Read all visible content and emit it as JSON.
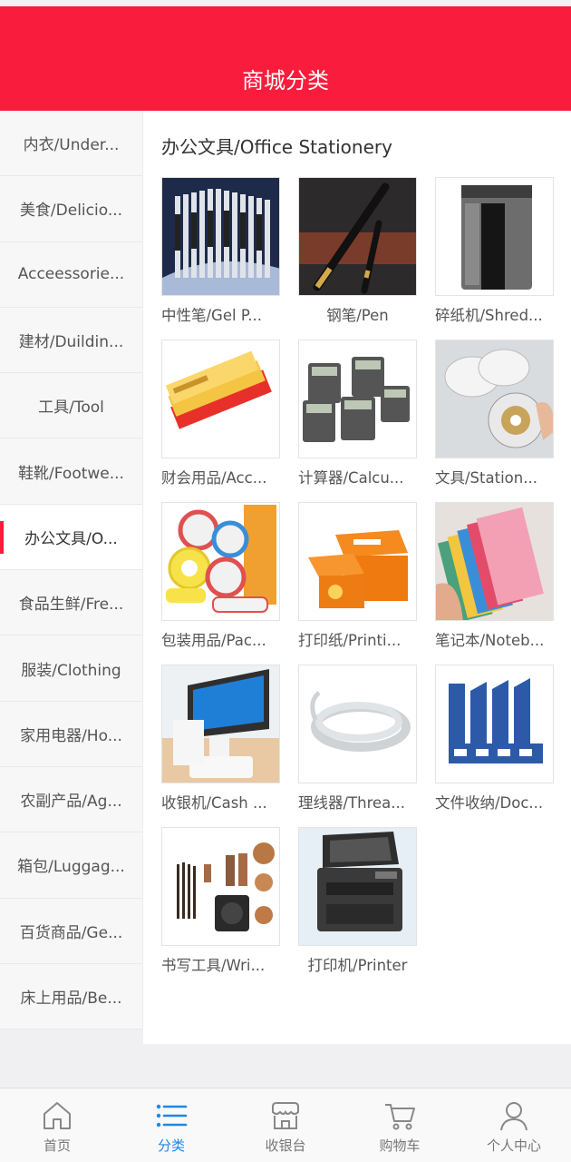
{
  "header": {
    "title": "商城分类"
  },
  "sidebar": {
    "items": [
      {
        "label": "内衣/Under..."
      },
      {
        "label": "美食/Delicio..."
      },
      {
        "label": "Acceessorie..."
      },
      {
        "label": "建材/Duildin..."
      },
      {
        "label": "工具/Tool"
      },
      {
        "label": "鞋靴/Footwe..."
      },
      {
        "label": "办公文具/O...",
        "active": true
      },
      {
        "label": "食品生鲜/Fre..."
      },
      {
        "label": "服装/Clothing"
      },
      {
        "label": "家用电器/Ho..."
      },
      {
        "label": "农副产品/Ag..."
      },
      {
        "label": "箱包/Luggag..."
      },
      {
        "label": "百货商品/Ge..."
      },
      {
        "label": "床上用品/Be..."
      }
    ]
  },
  "main": {
    "title": "办公文具/Office Stationery",
    "products": [
      {
        "label": "中性笔/Gel P...",
        "icon": "gel-pen-image"
      },
      {
        "label": "钢笔/Pen",
        "icon": "fountain-pen-image"
      },
      {
        "label": "碎纸机/Shred...",
        "icon": "shredder-image"
      },
      {
        "label": "财会用品/Acc...",
        "icon": "accounting-supplies-image"
      },
      {
        "label": "计算器/Calcu...",
        "icon": "calculator-image"
      },
      {
        "label": "文具/Station...",
        "icon": "stationery-tape-image"
      },
      {
        "label": "包装用品/Pac...",
        "icon": "packing-tape-image"
      },
      {
        "label": "打印纸/Printi...",
        "icon": "printing-paper-image"
      },
      {
        "label": "笔记本/Noteb...",
        "icon": "notebook-image"
      },
      {
        "label": "收银机/Cash ...",
        "icon": "cash-register-image"
      },
      {
        "label": "理线器/Threa...",
        "icon": "cable-organizer-image"
      },
      {
        "label": "文件收纳/Doc...",
        "icon": "document-holder-image"
      },
      {
        "label": "书写工具/Wri...",
        "icon": "writing-tools-image"
      },
      {
        "label": "打印机/Printer",
        "icon": "printer-image"
      }
    ]
  },
  "tabbar": {
    "tabs": [
      {
        "label": "首页",
        "icon": "home-icon"
      },
      {
        "label": "分类",
        "icon": "list-icon",
        "active": true
      },
      {
        "label": "收银台",
        "icon": "store-icon"
      },
      {
        "label": "购物车",
        "icon": "cart-icon"
      },
      {
        "label": "个人中心",
        "icon": "user-icon"
      }
    ]
  },
  "colors": {
    "brand": "#fa1c3c",
    "active_tab": "#1e88e5"
  }
}
